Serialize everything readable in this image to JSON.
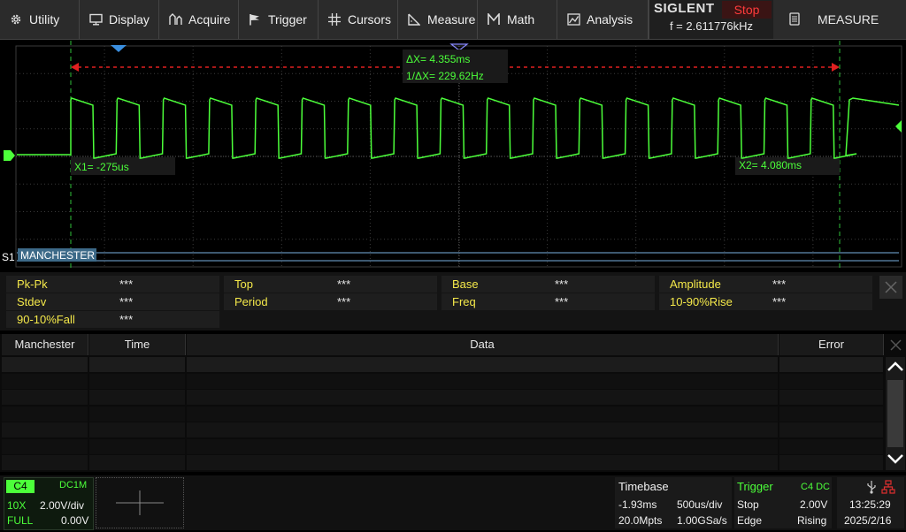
{
  "menu": {
    "items": [
      {
        "label": "Utility",
        "icon": "gear-icon"
      },
      {
        "label": "Display",
        "icon": "monitor-icon"
      },
      {
        "label": "Acquire",
        "icon": "acquire-icon"
      },
      {
        "label": "Trigger",
        "icon": "flag-icon"
      },
      {
        "label": "Cursors",
        "icon": "crosshair-icon"
      },
      {
        "label": "Measure",
        "icon": "measure-icon"
      },
      {
        "label": "Math",
        "icon": "math-icon"
      },
      {
        "label": "Analysis",
        "icon": "analysis-icon"
      }
    ],
    "brand": "SIGLENT",
    "run_state": "Stop",
    "frequency": "f = 2.611776kHz",
    "measure_button": "MEASURE"
  },
  "cursors": {
    "delta_x": "ΔX= 4.355ms",
    "inv_delta_x": "1/ΔX= 229.62Hz",
    "x1": "X1= -275us",
    "x2": "X2= 4.080ms"
  },
  "decode_channel": {
    "tag": "S1",
    "protocol": "MANCHESTER"
  },
  "measurements": [
    {
      "label": "Pk-Pk",
      "value": "***"
    },
    {
      "label": "Top",
      "value": "***"
    },
    {
      "label": "Base",
      "value": "***"
    },
    {
      "label": "Amplitude",
      "value": "***"
    },
    {
      "label": "Stdev",
      "value": "***"
    },
    {
      "label": "Period",
      "value": "***"
    },
    {
      "label": "Freq",
      "value": "***"
    },
    {
      "label": "10-90%Rise",
      "value": "***"
    },
    {
      "label": "90-10%Fall",
      "value": "***"
    }
  ],
  "decode_table": {
    "columns": [
      "Manchester",
      "Time",
      "Data",
      "Error"
    ]
  },
  "channel": {
    "name": "C4",
    "coupling": "DC1M",
    "probe": "10X",
    "scale": "2.00V/div",
    "bandwidth": "FULL",
    "offset": "0.00V"
  },
  "timebase": {
    "title": "Timebase",
    "delay": "-1.93ms",
    "scale": "500us/div",
    "memory": "20.0Mpts",
    "sample_rate": "1.00GSa/s"
  },
  "trigger": {
    "title": "Trigger",
    "source": "C4 DC",
    "state": "Stop",
    "level": "2.00V",
    "type": "Edge",
    "slope": "Rising"
  },
  "clock": {
    "time": "13:25:29",
    "date": "2025/2/16"
  },
  "colors": {
    "waveform": "#4cff3a",
    "cursor_line": "#2fbf3a",
    "delta_marker": "#e02020",
    "trigger_marker": "#3a8fe0",
    "label_yellow": "#f5e94a"
  }
}
